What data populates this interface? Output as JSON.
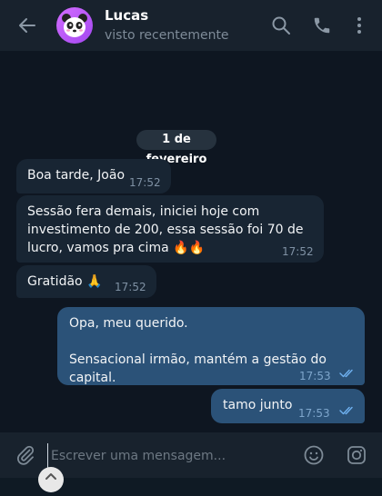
{
  "header": {
    "contact_name": "Lucas",
    "contact_status": "visto recentemente",
    "back_icon": "arrow-left-icon",
    "search_icon": "search-icon",
    "call_icon": "phone-icon",
    "menu_icon": "kebab-menu-icon"
  },
  "chat": {
    "date_separator": "1 de fevereiro",
    "messages": [
      {
        "direction": "incoming",
        "text": "Boa tarde, João",
        "time": "17:52"
      },
      {
        "direction": "incoming",
        "text": "Sessão fera demais, iniciei hoje com\ninvestimento de 200, essa sessão foi 70 de\nlucro, vamos pra cima 🔥🔥",
        "time": "17:52"
      },
      {
        "direction": "incoming",
        "text": "Gratidão 🙏",
        "time": "17:52"
      },
      {
        "direction": "outgoing",
        "text": "Opa, meu querido.\n\nSensacional irmão, mantém a gestão do capital.",
        "time": "17:53",
        "read": true
      },
      {
        "direction": "outgoing",
        "text": "tamo junto",
        "time": "17:53",
        "read": true
      }
    ]
  },
  "composer": {
    "placeholder": "Escrever uma mensagem...",
    "attach_icon": "paperclip-icon",
    "emoji_icon": "smiley-icon",
    "camera_icon": "instagram-camera-icon"
  },
  "colors": {
    "background": "#0e1621",
    "header": "#18222d",
    "incoming_bubble": "#182533",
    "outgoing_bubble": "#2b5278",
    "read_ticks": "#6fb1f0"
  }
}
